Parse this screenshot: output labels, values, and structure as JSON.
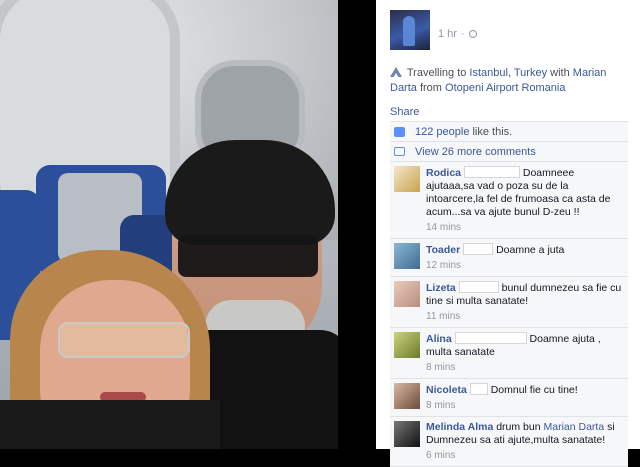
{
  "post": {
    "time": "1 hr",
    "privacy_icon": "globe-icon",
    "travel": {
      "prefix": "Travelling to ",
      "city": "Istanbul",
      "sep": ", ",
      "country": "Turkey",
      "with": " with ",
      "person": "Marian Darta",
      "from": " from ",
      "origin": "Otopeni Airport Romania"
    },
    "share_label": "Share"
  },
  "ufi": {
    "likes_count": "122 people",
    "likes_suffix": "like this.",
    "more_comments": "View 26 more comments"
  },
  "comments": [
    {
      "name": "Rodica",
      "text": "Doamneee ajutaaa,sa vad o poza su de la intoarcere,la fel de frumoasa ca asta de acum...sa va ajute bunul D-zeu !!",
      "time": "14 mins"
    },
    {
      "name": "Toader",
      "text": "Doamne a juta",
      "time": "12 mins"
    },
    {
      "name": "Lizeta",
      "text": "bunul dumnezeu sa fie cu tine si multa sanatate!",
      "time": "11 mins"
    },
    {
      "name": "Alina",
      "text": "Doamne ajuta , multa sanatate",
      "time": "8 mins"
    },
    {
      "name": "Nicoleta",
      "text": "Domnul fie cu tine!",
      "time": "8 mins"
    },
    {
      "name": "Melinda Alma",
      "text_a": "drum bun ",
      "link": "Marian Darta",
      "text_b": " si Dumnezeu sa ati ajute,multa sanatate!",
      "time": "6 mins"
    }
  ]
}
